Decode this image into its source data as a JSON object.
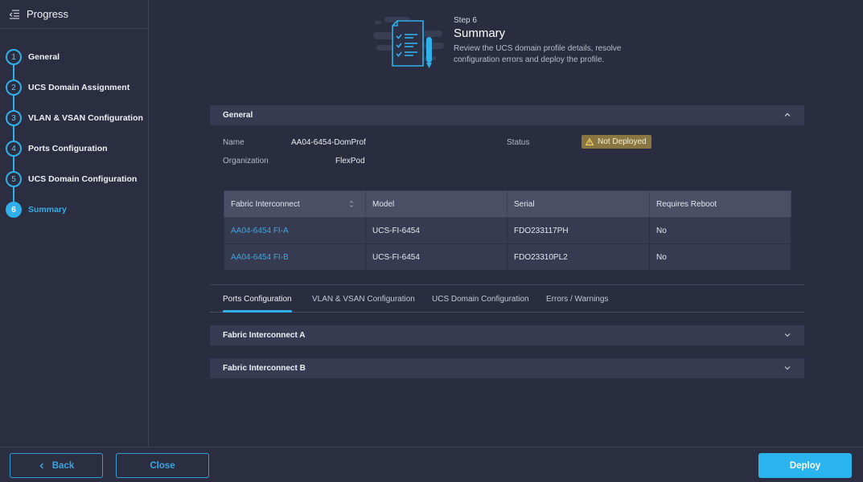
{
  "sidebar": {
    "title": "Progress",
    "steps": [
      {
        "number": "1",
        "label": "General",
        "active": false
      },
      {
        "number": "2",
        "label": "UCS Domain Assignment",
        "active": false
      },
      {
        "number": "3",
        "label": "VLAN & VSAN Configuration",
        "active": false
      },
      {
        "number": "4",
        "label": "Ports Configuration",
        "active": false
      },
      {
        "number": "5",
        "label": "UCS Domain Configuration",
        "active": false
      },
      {
        "number": "6",
        "label": "Summary",
        "active": true
      }
    ]
  },
  "hero": {
    "step": "Step 6",
    "title": "Summary",
    "description": "Review the UCS domain profile details, resolve configuration errors and deploy the profile."
  },
  "general": {
    "header": "General",
    "name_label": "Name",
    "name_value": "AA04-6454-DomProf",
    "org_label": "Organization",
    "org_value": "FlexPod",
    "status_label": "Status",
    "status_value": "Not Deployed",
    "status_color": "#8a7640"
  },
  "table": {
    "columns": [
      "Fabric Interconnect",
      "Model",
      "Serial",
      "Requires Reboot"
    ],
    "rows": [
      {
        "name": "AA04-6454 FI-A",
        "model": "UCS-FI-6454",
        "serial": "FDO233117PH",
        "reboot": "No"
      },
      {
        "name": "AA04-6454 FI-B",
        "model": "UCS-FI-6454",
        "serial": "FDO23310PL2",
        "reboot": "No"
      }
    ]
  },
  "tabs": [
    {
      "label": "Ports Configuration",
      "active": true
    },
    {
      "label": "VLAN & VSAN Configuration",
      "active": false
    },
    {
      "label": "UCS Domain Configuration",
      "active": false
    },
    {
      "label": "Errors / Warnings",
      "active": false
    }
  ],
  "accordions": [
    {
      "label": "Fabric Interconnect A"
    },
    {
      "label": "Fabric Interconnect B"
    }
  ],
  "footer": {
    "back_label": "Back",
    "close_label": "Close",
    "deploy_label": "Deploy"
  },
  "colors": {
    "accent": "#2fb0ea",
    "link": "#3ea5dc",
    "warning": "#8a7640"
  }
}
